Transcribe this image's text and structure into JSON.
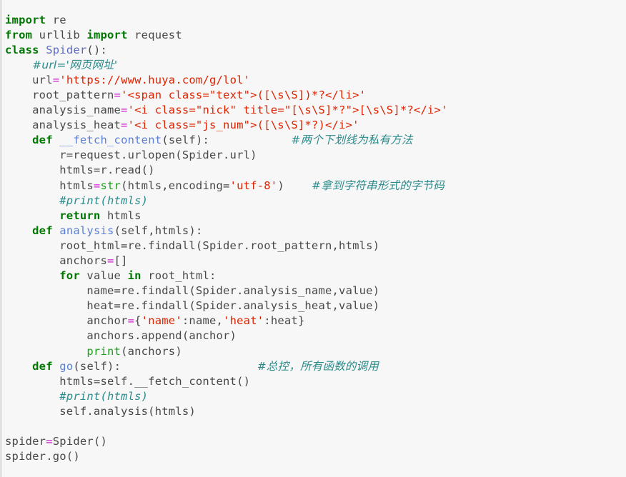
{
  "document": {
    "kind": "python-source-screenshot",
    "language": "Python",
    "background_color": "#f7f7f7",
    "default_text_color": "#484848",
    "palette": {
      "keyword": "#007700",
      "class_name": "#5c6bc0",
      "function_name": "#5b7fd4",
      "builtin": "#19a319",
      "string": "#dd2200",
      "operator": "#cc22cc",
      "comment": "#2b8a8a",
      "left_rule": "#e2e2e2"
    }
  },
  "code": {
    "lines": [
      {
        "n": 1,
        "tokens": [
          {
            "t": "kw",
            "v": "import"
          },
          {
            "t": "pl",
            "v": " re"
          }
        ]
      },
      {
        "n": 2,
        "tokens": [
          {
            "t": "kw",
            "v": "from"
          },
          {
            "t": "pl",
            "v": " urllib "
          },
          {
            "t": "kw",
            "v": "import"
          },
          {
            "t": "pl",
            "v": " request"
          }
        ]
      },
      {
        "n": 3,
        "tokens": [
          {
            "t": "kw",
            "v": "class"
          },
          {
            "t": "pl",
            "v": " "
          },
          {
            "t": "cls",
            "v": "Spider"
          },
          {
            "t": "pl",
            "v": "():"
          }
        ]
      },
      {
        "n": 4,
        "tokens": [
          {
            "t": "pl",
            "v": "    "
          },
          {
            "t": "cmt-cn",
            "v": "#url='网页网址'"
          }
        ]
      },
      {
        "n": 5,
        "tokens": [
          {
            "t": "pl",
            "v": "    url"
          },
          {
            "t": "op",
            "v": "="
          },
          {
            "t": "str",
            "v": "'https://www.huya.com/g/lol'"
          }
        ]
      },
      {
        "n": 6,
        "tokens": [
          {
            "t": "pl",
            "v": "    root_pattern"
          },
          {
            "t": "op",
            "v": "="
          },
          {
            "t": "str",
            "v": "'<span class=\"text\">([\\s\\S])*?</li>'"
          }
        ]
      },
      {
        "n": 7,
        "tokens": [
          {
            "t": "pl",
            "v": "    analysis_name"
          },
          {
            "t": "op",
            "v": "="
          },
          {
            "t": "str",
            "v": "'<i class=\"nick\" title=\"[\\s\\S]*?\">[\\s\\S]*?</i>'"
          }
        ]
      },
      {
        "n": 8,
        "tokens": [
          {
            "t": "pl",
            "v": "    analysis_heat"
          },
          {
            "t": "op",
            "v": "="
          },
          {
            "t": "str",
            "v": "'<i class=\"js_num\">([\\s\\S]*?)</i>'"
          }
        ]
      },
      {
        "n": 9,
        "tokens": [
          {
            "t": "pl",
            "v": "    "
          },
          {
            "t": "kw",
            "v": "def"
          },
          {
            "t": "pl",
            "v": " "
          },
          {
            "t": "fn",
            "v": "__fetch_content"
          },
          {
            "t": "pl",
            "v": "(self):"
          },
          {
            "t": "pl",
            "v": "            "
          },
          {
            "t": "cmt-cn",
            "v": "#两个下划线为私有方法"
          }
        ]
      },
      {
        "n": 10,
        "tokens": [
          {
            "t": "pl",
            "v": "        r=request.urlopen(Spider.url)"
          }
        ]
      },
      {
        "n": 11,
        "tokens": [
          {
            "t": "pl",
            "v": "        htmls=r.read()"
          }
        ]
      },
      {
        "n": 12,
        "tokens": [
          {
            "t": "pl",
            "v": "        htmls"
          },
          {
            "t": "op",
            "v": "="
          },
          {
            "t": "bi",
            "v": "str"
          },
          {
            "t": "pl",
            "v": "(htmls,encoding="
          },
          {
            "t": "str",
            "v": "'utf-8'"
          },
          {
            "t": "pl",
            "v": ")    "
          },
          {
            "t": "cmt-cn",
            "v": "#拿到字符串形式的字节码"
          }
        ]
      },
      {
        "n": 13,
        "tokens": [
          {
            "t": "pl",
            "v": "        "
          },
          {
            "t": "cmt",
            "v": "#print(htmls)"
          }
        ]
      },
      {
        "n": 14,
        "tokens": [
          {
            "t": "pl",
            "v": "        "
          },
          {
            "t": "kw",
            "v": "return"
          },
          {
            "t": "pl",
            "v": " htmls"
          }
        ]
      },
      {
        "n": 15,
        "tokens": [
          {
            "t": "pl",
            "v": "    "
          },
          {
            "t": "kw",
            "v": "def"
          },
          {
            "t": "pl",
            "v": " "
          },
          {
            "t": "fn",
            "v": "analysis"
          },
          {
            "t": "pl",
            "v": "(self,htmls):"
          }
        ]
      },
      {
        "n": 16,
        "tokens": [
          {
            "t": "pl",
            "v": "        root_html=re.findall(Spider.root_pattern,htmls)"
          }
        ]
      },
      {
        "n": 17,
        "tokens": [
          {
            "t": "pl",
            "v": "        anchors"
          },
          {
            "t": "op",
            "v": "="
          },
          {
            "t": "pl",
            "v": "[]"
          }
        ]
      },
      {
        "n": 18,
        "tokens": [
          {
            "t": "pl",
            "v": "        "
          },
          {
            "t": "kw",
            "v": "for"
          },
          {
            "t": "pl",
            "v": " value "
          },
          {
            "t": "kw",
            "v": "in"
          },
          {
            "t": "pl",
            "v": " root_html:"
          }
        ]
      },
      {
        "n": 19,
        "tokens": [
          {
            "t": "pl",
            "v": "            name=re.findall(Spider.analysis_name,value)"
          }
        ]
      },
      {
        "n": 20,
        "tokens": [
          {
            "t": "pl",
            "v": "            heat=re.findall(Spider.analysis_heat,value)"
          }
        ]
      },
      {
        "n": 21,
        "tokens": [
          {
            "t": "pl",
            "v": "            anchor"
          },
          {
            "t": "op",
            "v": "="
          },
          {
            "t": "pl",
            "v": "{"
          },
          {
            "t": "str",
            "v": "'name'"
          },
          {
            "t": "pl",
            "v": ":name,"
          },
          {
            "t": "str",
            "v": "'heat'"
          },
          {
            "t": "pl",
            "v": ":heat}"
          }
        ]
      },
      {
        "n": 22,
        "tokens": [
          {
            "t": "pl",
            "v": "            anchors.append(anchor)"
          }
        ]
      },
      {
        "n": 23,
        "tokens": [
          {
            "t": "pl",
            "v": "            "
          },
          {
            "t": "bi",
            "v": "print"
          },
          {
            "t": "pl",
            "v": "(anchors)"
          }
        ]
      },
      {
        "n": 24,
        "tokens": [
          {
            "t": "pl",
            "v": "    "
          },
          {
            "t": "kw",
            "v": "def"
          },
          {
            "t": "pl",
            "v": " "
          },
          {
            "t": "fn",
            "v": "go"
          },
          {
            "t": "pl",
            "v": "(self):"
          },
          {
            "t": "pl",
            "v": "                    "
          },
          {
            "t": "cmt-cn",
            "v": "#总控，所有函数的调用"
          }
        ]
      },
      {
        "n": 25,
        "tokens": [
          {
            "t": "pl",
            "v": "        htmls=self.__fetch_content()"
          }
        ]
      },
      {
        "n": 26,
        "tokens": [
          {
            "t": "pl",
            "v": "        "
          },
          {
            "t": "cmt",
            "v": "#print(htmls)"
          }
        ]
      },
      {
        "n": 27,
        "tokens": [
          {
            "t": "pl",
            "v": "        self.analysis(htmls)"
          }
        ]
      },
      {
        "n": 28,
        "tokens": []
      },
      {
        "n": 29,
        "tokens": [
          {
            "t": "pl",
            "v": "spider"
          },
          {
            "t": "op",
            "v": "="
          },
          {
            "t": "pl",
            "v": "Spider()"
          }
        ]
      },
      {
        "n": 30,
        "tokens": [
          {
            "t": "pl",
            "v": "spider.go()"
          }
        ]
      }
    ]
  }
}
